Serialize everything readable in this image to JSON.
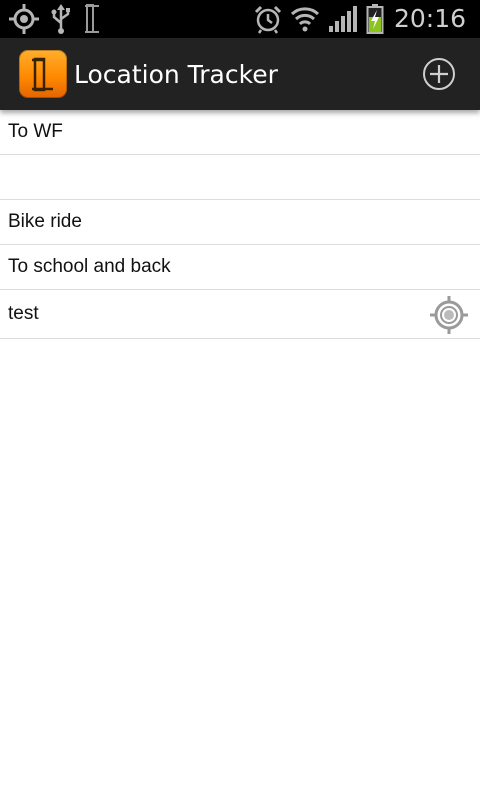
{
  "status_bar": {
    "time": "20:16",
    "icons": [
      "gps-icon",
      "usb-icon",
      "app-notification-icon",
      "alarm-icon",
      "wifi-icon",
      "signal-icon",
      "battery-charging-icon"
    ]
  },
  "action_bar": {
    "title": "Location Tracker",
    "app_icon": "location-tracker-logo",
    "action_icon": "add-circle-icon",
    "colors": {
      "bar": "#222222",
      "accent": "#ff8a00"
    }
  },
  "tracks": [
    {
      "label": "To WF"
    },
    {
      "label": ""
    },
    {
      "label": "Bike ride"
    },
    {
      "label": "To school and back"
    },
    {
      "label": "test",
      "icon": "locate-target-icon"
    }
  ]
}
